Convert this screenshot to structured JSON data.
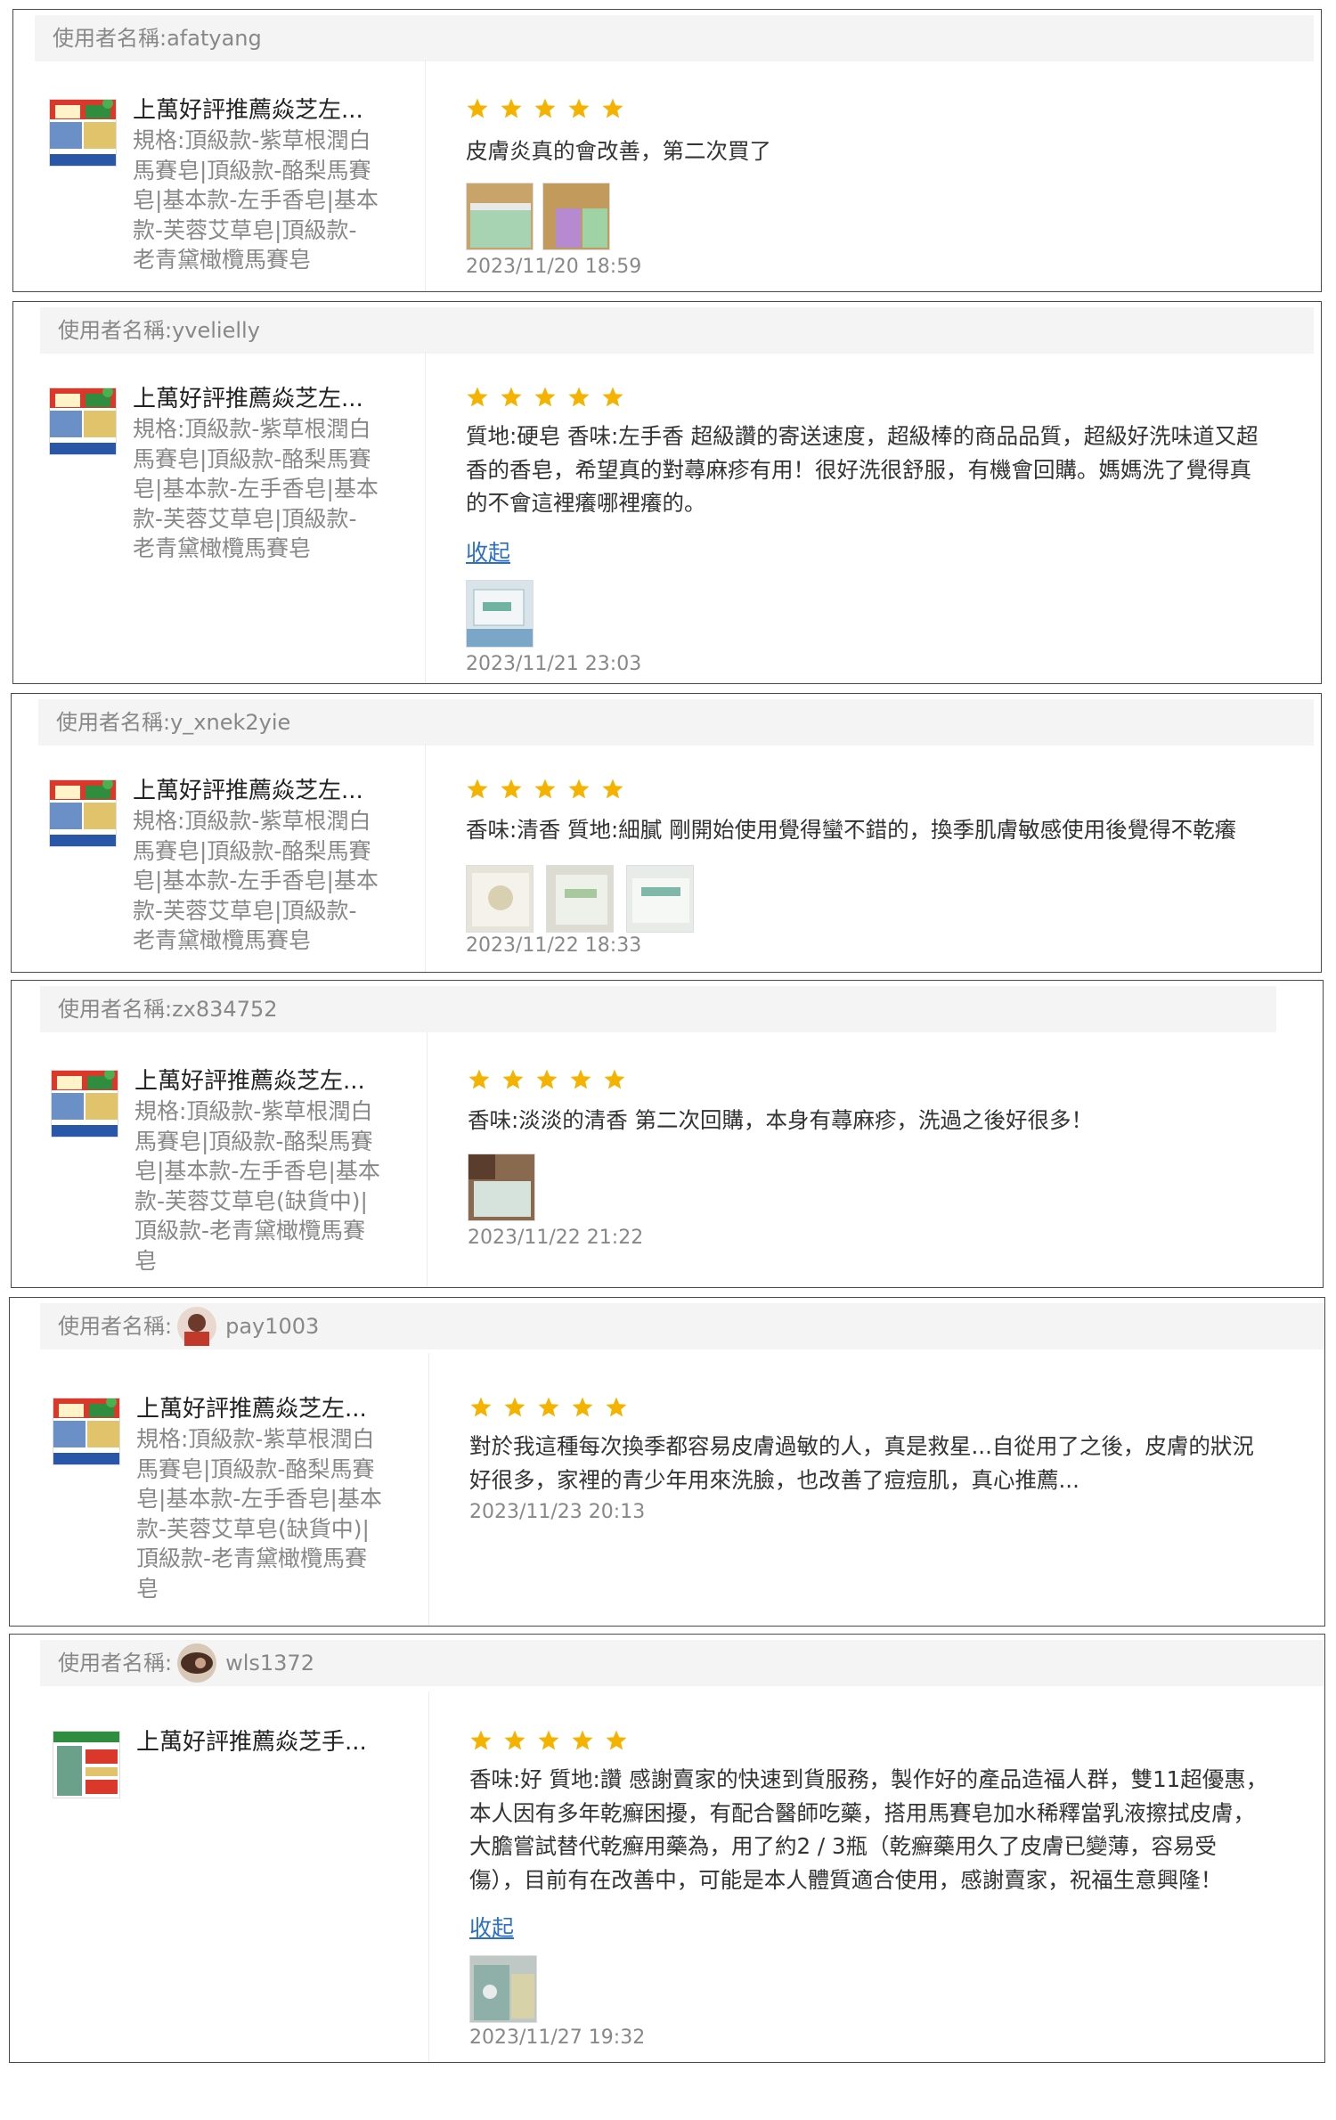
{
  "username_prefix": "使用者名稱:",
  "star_color": "#f5b301",
  "link_color": "#2b6fc7",
  "product": {
    "title_full": "上萬好評推薦焱芝左...",
    "title_short": "上萬好評推薦焱芝手..."
  },
  "reviews": [
    {
      "username": "afatyang",
      "spec_lines": [
        "規格:頂級款-紫草根潤白",
        "馬賽皂|頂級款-酪梨馬賽",
        "皂|基本款-左手香皂|基本",
        "款-芙蓉艾草皂|頂級款-",
        "老青黛橄欖馬賽皂"
      ],
      "rating": 5,
      "text_lines": [
        "皮膚炎真的會改善，第二次買了"
      ],
      "collapse_label": "",
      "photo_count": 2,
      "date": "2023/11/20 18:59"
    },
    {
      "username": "yvelielly",
      "spec_lines": [
        "規格:頂級款-紫草根潤白",
        "馬賽皂|頂級款-酪梨馬賽",
        "皂|基本款-左手香皂|基本",
        "款-芙蓉艾草皂|頂級款-",
        "老青黛橄欖馬賽皂"
      ],
      "rating": 5,
      "text_lines": [
        "質地:硬皂 香味:左手香 超級讚的寄送速度，超級棒的商品品質，超級好洗味道又超",
        "香的香皂，希望真的對蕁麻疹有用！很好洗很舒服，有機會回購。媽媽洗了覺得真",
        "的不會這裡癢哪裡癢的。"
      ],
      "collapse_label": "收起",
      "photo_count": 1,
      "date": "2023/11/21 23:03"
    },
    {
      "username": "y_xnek2yie",
      "spec_lines": [
        "規格:頂級款-紫草根潤白",
        "馬賽皂|頂級款-酪梨馬賽",
        "皂|基本款-左手香皂|基本",
        "款-芙蓉艾草皂|頂級款-",
        "老青黛橄欖馬賽皂"
      ],
      "rating": 5,
      "text_lines": [
        "香味:清香 質地:細膩 剛開始使用覺得蠻不錯的，換季肌膚敏感使用後覺得不乾癢"
      ],
      "collapse_label": "",
      "photo_count": 3,
      "date": "2023/11/22 18:33"
    },
    {
      "username": "zx834752",
      "spec_lines": [
        "規格:頂級款-紫草根潤白",
        "馬賽皂|頂級款-酪梨馬賽",
        "皂|基本款-左手香皂|基本",
        "款-芙蓉艾草皂(缺貨中)|",
        "頂級款-老青黛橄欖馬賽",
        "皂"
      ],
      "rating": 5,
      "text_lines": [
        "香味:淡淡的清香 第二次回購，本身有蕁麻疹，洗過之後好很多！"
      ],
      "collapse_label": "",
      "photo_count": 1,
      "date": "2023/11/22 21:22"
    },
    {
      "username": "pay1003",
      "spec_lines": [
        "規格:頂級款-紫草根潤白",
        "馬賽皂|頂級款-酪梨馬賽",
        "皂|基本款-左手香皂|基本",
        "款-芙蓉艾草皂(缺貨中)|",
        "頂級款-老青黛橄欖馬賽",
        "皂"
      ],
      "rating": 5,
      "text_lines": [
        "對於我這種每次換季都容易皮膚過敏的人，真是救星...自從用了之後，皮膚的狀況",
        "好很多，家裡的青少年用來洗臉，也改善了痘痘肌，真心推薦..."
      ],
      "collapse_label": "",
      "photo_count": 0,
      "date": "2023/11/23 20:13"
    },
    {
      "username": "wls1372",
      "spec_lines": [],
      "rating": 5,
      "text_lines": [
        "香味:好 質地:讚 感謝賣家的快速到貨服務，製作好的產品造福人群，雙11超優惠，",
        "本人因有多年乾癬困擾，有配合醫師吃藥，搭用馬賽皂加水稀釋當乳液擦拭皮膚，",
        "大膽嘗試替代乾癬用藥為，用了約2 / 3瓶（乾癬藥用久了皮膚已變薄，容易受",
        "傷），目前有在改善中，可能是本人體質適合使用，感謝賣家，祝福生意興隆！"
      ],
      "collapse_label": "收起",
      "photo_count": 1,
      "date": "2023/11/27 19:32"
    }
  ]
}
